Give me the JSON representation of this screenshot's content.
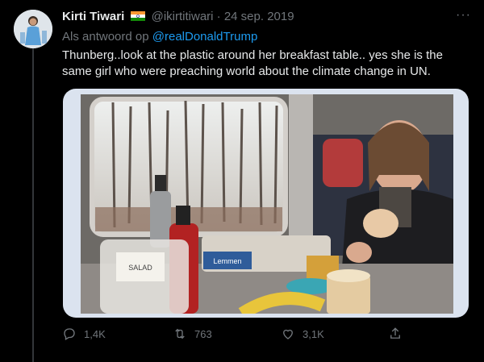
{
  "tweet": {
    "author_name": "Kirti Tiwari",
    "handle": "@ikirtitiwari",
    "separator": "·",
    "date": "24 sep. 2019",
    "flag_icon": "india-flag-icon",
    "more_icon": "···",
    "reply_prefix": "Als antwoord op",
    "reply_mention": "@realDonaldTrump",
    "text": "Thunberg..look at the plastic around her breakfast table..  yes she is the same girl who were preaching world about the climate change in UN."
  },
  "media": {
    "bottle_label": "SALAD",
    "bag_label": "Lemmen"
  },
  "actions": {
    "reply_count": "1,4K",
    "retweet_count": "763",
    "like_count": "3,1K"
  },
  "colors": {
    "background": "#000000",
    "link": "#1d9bf0",
    "muted": "#71767b",
    "text": "#e7e9ea"
  }
}
